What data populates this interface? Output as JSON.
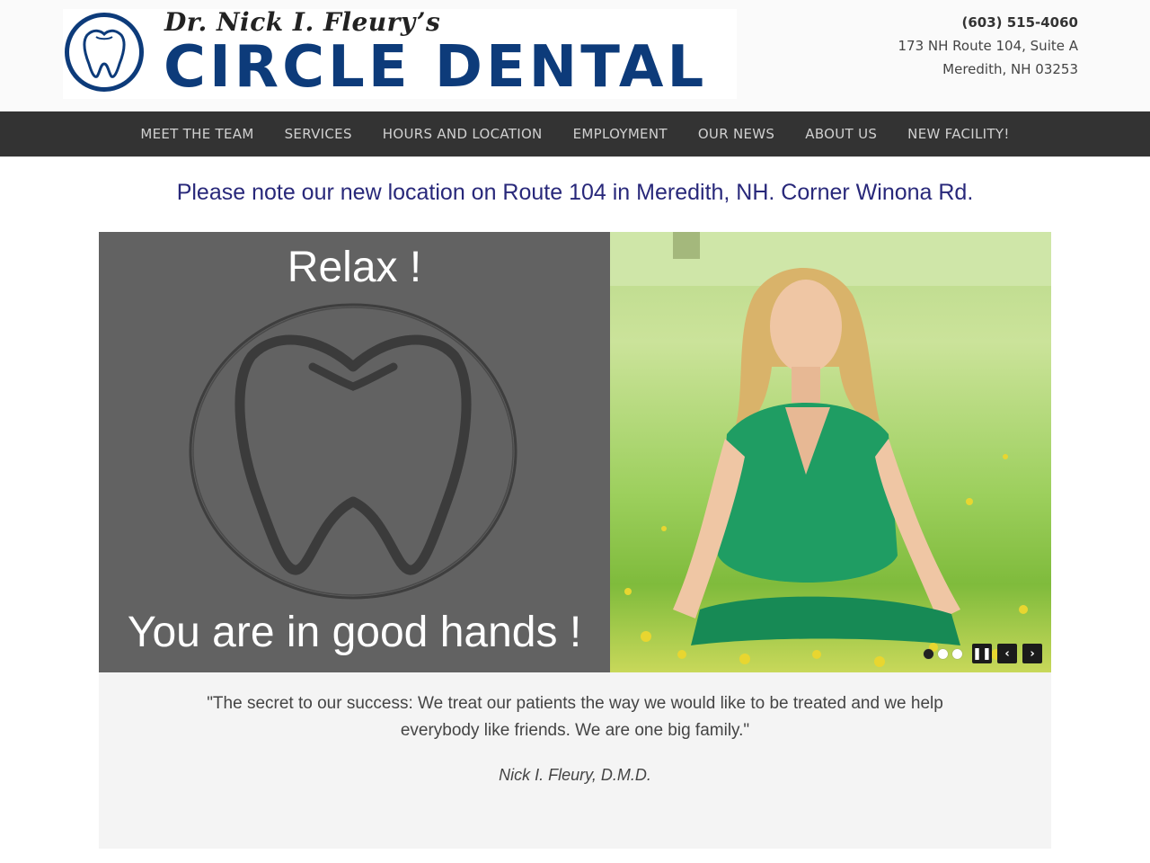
{
  "header": {
    "logo_top": "Dr. Nick I. Fleury’s",
    "logo_main": "CIRCLE DENTAL",
    "phone": "(603) 515-4060",
    "address_line1": "173 NH Route 104, Suite A",
    "address_line2": "Meredith, NH 03253"
  },
  "nav": {
    "items": [
      {
        "label": "MEET THE TEAM"
      },
      {
        "label": "SERVICES"
      },
      {
        "label": "HOURS AND LOCATION"
      },
      {
        "label": "EMPLOYMENT"
      },
      {
        "label": "OUR NEWS"
      },
      {
        "label": "ABOUT US"
      },
      {
        "label": "NEW FACILITY!"
      }
    ]
  },
  "notice": "Please note our new location on Route 104 in Meredith, NH. Corner Winona Rd.",
  "slider": {
    "heading": "Relax !",
    "caption": "You are in good hands !",
    "slide_count": 3,
    "active_slide": 1
  },
  "quote": {
    "text": "\"The secret to our success: We treat our patients the way we would like to be treated and we help everybody like friends. We are one big family.\"",
    "author": "Nick I. Fleury, D.M.D."
  },
  "colors": {
    "brand_blue": "#0d3b7a",
    "nav_bg": "#333333",
    "notice_text": "#28287a",
    "slide_bg": "#626262"
  }
}
